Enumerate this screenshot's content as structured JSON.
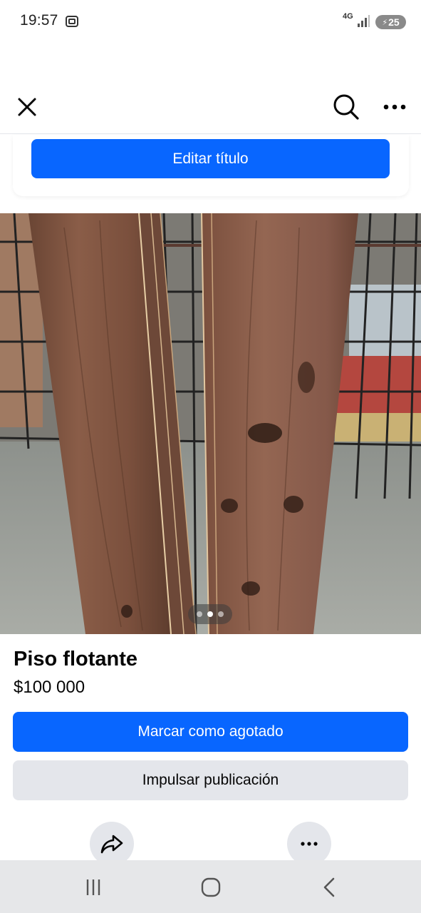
{
  "status_bar": {
    "time": "19:57",
    "network": "4G",
    "battery": "25",
    "icons": [
      "screenshot-icon",
      "signal-icon",
      "battery-charging-icon"
    ]
  },
  "header": {
    "icons": [
      "close-icon",
      "search-icon",
      "more-horizontal-icon"
    ]
  },
  "edit_title_button": "Editar título",
  "photo": {
    "description_icon": "listing-photo",
    "carousel": {
      "count": 3,
      "active_index": 1
    }
  },
  "listing": {
    "title": "Piso flotante",
    "price": "$100 000"
  },
  "actions": {
    "mark_sold": "Marcar como agotado",
    "boost": "Impulsar publicación",
    "icons": [
      "share-icon",
      "more-horizontal-icon"
    ]
  },
  "nav_bar": {
    "icons": [
      "recents-icon",
      "home-icon",
      "back-icon"
    ]
  },
  "colors": {
    "primary": "#0866ff",
    "secondary_button": "#e4e6eb",
    "nav_bar": "#e6e7e9",
    "text": "#050505"
  }
}
